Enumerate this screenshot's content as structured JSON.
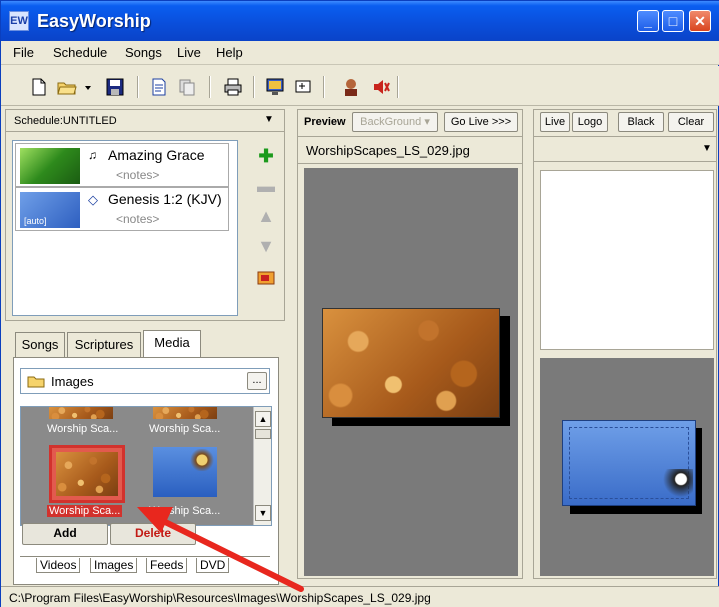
{
  "window": {
    "title": "EasyWorship",
    "app_icon": "easyworship-logo-icon"
  },
  "menu": [
    "File",
    "Schedule",
    "Songs",
    "Live",
    "Help"
  ],
  "toolbar_icons": [
    "new-file-icon",
    "open-folder-icon",
    "dropdown-arrow-icon",
    "save-icon",
    "document-icon",
    "copy-icon",
    "print-icon",
    "monitor-icon",
    "display-icon",
    "person-icon",
    "speaker-mute-icon"
  ],
  "schedule": {
    "header": "Schedule:UNTITLED",
    "items": [
      {
        "title": "Amazing Grace",
        "notes": "<notes>",
        "icon": "song-icon"
      },
      {
        "title": "Genesis 1:2 (KJV)",
        "notes": "<notes>",
        "icon": "bible-icon",
        "thumb_label": "[auto]"
      }
    ]
  },
  "library_tabs": [
    "Songs",
    "Scriptures",
    "Media"
  ],
  "media": {
    "folder": "Images",
    "browse_label": "...",
    "items": [
      "Worship Sca...",
      "Worship Sca...",
      "Worship Sca...",
      "Worship Sca..."
    ],
    "add_label": "Add",
    "delete_label": "Delete",
    "sub_tabs": [
      "Videos",
      "Images",
      "Feeds",
      "DVD"
    ]
  },
  "preview": {
    "label": "Preview",
    "background_label": "BackGround",
    "golive_label": "Go Live >>>",
    "filename": "WorshipScapes_LS_029.jpg"
  },
  "live": {
    "live_label": "Live",
    "logo_label": "Logo",
    "black_label": "Black",
    "clear_label": "Clear"
  },
  "status": {
    "path": "C:\\Program Files\\EasyWorship\\Resources\\Images\\WorshipScapes_LS_029.jpg"
  },
  "colors": {
    "titlebar": "#0a4fdc",
    "selection": "#d2322d",
    "annotation_arrow": "#e8271e"
  }
}
